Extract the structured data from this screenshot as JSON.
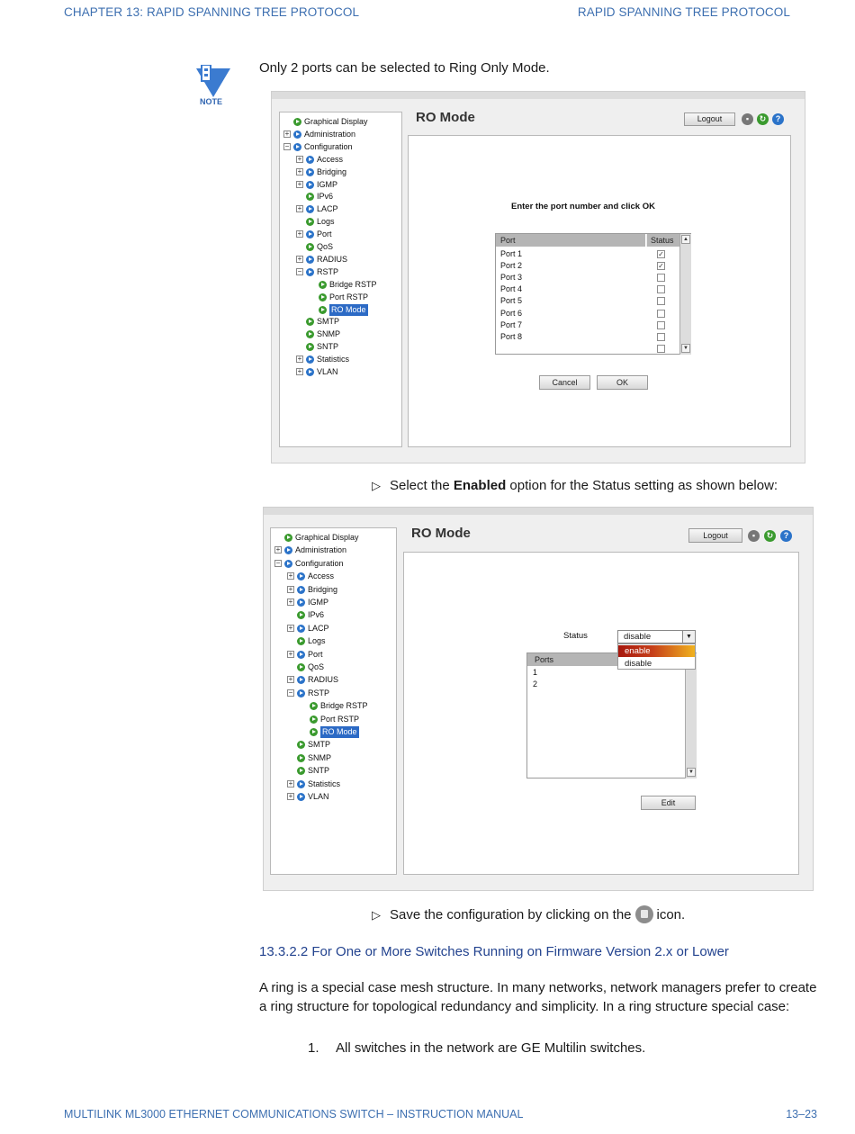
{
  "header": {
    "left": "CHAPTER 13: RAPID SPANNING TREE PROTOCOL",
    "right": "RAPID SPANNING TREE PROTOCOL"
  },
  "note": {
    "label": "NOTE",
    "text": "Only 2 ports can be selected to Ring Only Mode."
  },
  "nav_tree": [
    {
      "label": "Graphical Display",
      "level": 0,
      "expander": "",
      "bullet": "green"
    },
    {
      "label": "Administration",
      "level": 0,
      "expander": "+",
      "bullet": "blue"
    },
    {
      "label": "Configuration",
      "level": 0,
      "expander": "-",
      "bullet": "blue"
    },
    {
      "label": "Access",
      "level": 1,
      "expander": "+",
      "bullet": "blue"
    },
    {
      "label": "Bridging",
      "level": 1,
      "expander": "+",
      "bullet": "blue"
    },
    {
      "label": "IGMP",
      "level": 1,
      "expander": "+",
      "bullet": "blue"
    },
    {
      "label": "IPv6",
      "level": 1,
      "expander": "",
      "bullet": "green"
    },
    {
      "label": "LACP",
      "level": 1,
      "expander": "+",
      "bullet": "blue"
    },
    {
      "label": "Logs",
      "level": 1,
      "expander": "",
      "bullet": "green"
    },
    {
      "label": "Port",
      "level": 1,
      "expander": "+",
      "bullet": "blue"
    },
    {
      "label": "QoS",
      "level": 1,
      "expander": "",
      "bullet": "green"
    },
    {
      "label": "RADIUS",
      "level": 1,
      "expander": "+",
      "bullet": "blue"
    },
    {
      "label": "RSTP",
      "level": 1,
      "expander": "-",
      "bullet": "blue"
    },
    {
      "label": "Bridge RSTP",
      "level": 2,
      "expander": "",
      "bullet": "green"
    },
    {
      "label": "Port RSTP",
      "level": 2,
      "expander": "",
      "bullet": "green"
    },
    {
      "label": "RO Mode",
      "level": 2,
      "expander": "",
      "bullet": "green",
      "selected": true
    },
    {
      "label": "SMTP",
      "level": 1,
      "expander": "",
      "bullet": "green"
    },
    {
      "label": "SNMP",
      "level": 1,
      "expander": "",
      "bullet": "green"
    },
    {
      "label": "SNTP",
      "level": 1,
      "expander": "",
      "bullet": "green"
    },
    {
      "label": "Statistics",
      "level": 1,
      "expander": "+",
      "bullet": "blue"
    },
    {
      "label": "VLAN",
      "level": 1,
      "expander": "+",
      "bullet": "blue"
    }
  ],
  "shot1": {
    "title": "RO Mode",
    "logout": "Logout",
    "instruction": "Enter the port number and click OK",
    "col_port": "Port",
    "col_status": "Status",
    "rows": [
      {
        "port": "Port 1",
        "checked": true
      },
      {
        "port": "Port 2",
        "checked": true
      },
      {
        "port": "Port 3",
        "checked": false
      },
      {
        "port": "Port 4",
        "checked": false
      },
      {
        "port": "Port 5",
        "checked": false
      },
      {
        "port": "Port 6",
        "checked": false
      },
      {
        "port": "Port 7",
        "checked": false
      },
      {
        "port": "Port 8",
        "checked": false
      },
      {
        "port": "",
        "checked": false
      }
    ],
    "cancel": "Cancel",
    "ok": "OK"
  },
  "step1": {
    "before": "Select the ",
    "bold": "Enabled",
    "after": " option for the Status setting as shown below:"
  },
  "shot2": {
    "title": "RO Mode",
    "logout": "Logout",
    "status_label": "Status",
    "status_value": "disable",
    "options": [
      "enable",
      "disable"
    ],
    "highlighted_option": "enable",
    "col_ports": "Ports",
    "ports": [
      "1",
      "2"
    ],
    "edit": "Edit"
  },
  "step2": {
    "before": "Save the configuration by clicking on the",
    "after": "icon."
  },
  "section": {
    "heading": "13.3.2.2  For One or More Switches Running on Firmware Version 2.x or Lower",
    "paragraph": "A ring is a special case mesh structure. In many networks, network managers prefer to create a ring structure for topological redundancy and simplicity. In a ring structure special case:",
    "list_number": "1.",
    "list_text": "All switches in the network are GE Multilin switches."
  },
  "footer": {
    "left": "MULTILINK ML3000 ETHERNET COMMUNICATIONS SWITCH – INSTRUCTION MANUAL",
    "right": "13–23"
  }
}
